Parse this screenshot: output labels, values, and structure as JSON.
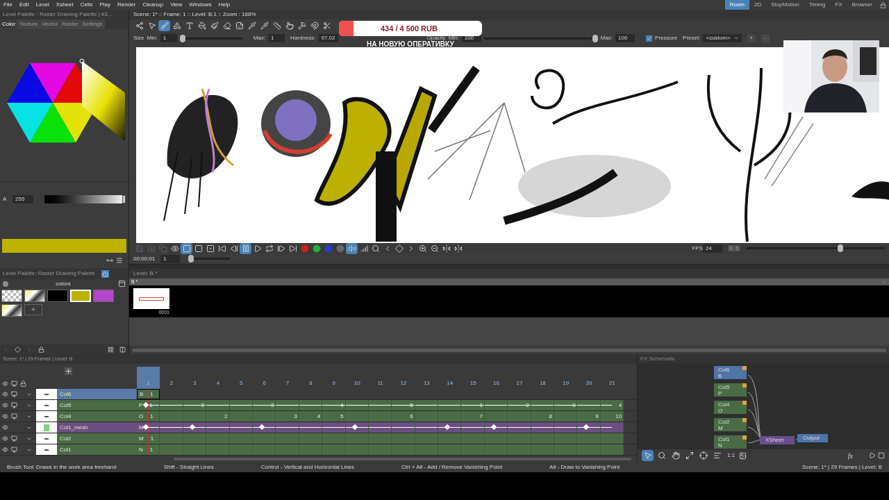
{
  "menu": [
    "File",
    "Edit",
    "Level",
    "Xsheet",
    "Cells",
    "Play",
    "Render",
    "Cleanup",
    "View",
    "Windows",
    "Help"
  ],
  "rooms": [
    {
      "label": "Room",
      "selected": true
    },
    {
      "label": "2D",
      "selected": false
    },
    {
      "label": "StopMotion",
      "selected": false
    },
    {
      "label": "Timing",
      "selected": false
    },
    {
      "label": "FX",
      "selected": false
    },
    {
      "label": "Browser",
      "selected": false
    }
  ],
  "style_editor": {
    "title": "Level Palette : Raster Drawing Palette | #3...",
    "tabs": [
      {
        "label": "Color",
        "selected": true
      },
      {
        "label": "Texture",
        "selected": false
      },
      {
        "label": "Vector",
        "selected": false
      },
      {
        "label": "Raster",
        "selected": false
      },
      {
        "label": "Settings",
        "selected": false
      }
    ],
    "alpha": {
      "label": "A",
      "value": "255",
      "level": 1
    }
  },
  "level_palette": {
    "title": "Level Palette: Raster Drawing Palette",
    "page": "colors",
    "styles": [
      {
        "kind": "checker",
        "selected": false
      },
      {
        "kind": "texture",
        "selected": false
      },
      {
        "kind": "solid",
        "color": "#000000",
        "selected": false
      },
      {
        "kind": "solid",
        "color": "#bcb300",
        "selected": true
      },
      {
        "kind": "solid",
        "color": "#b445c8",
        "selected": false
      },
      {
        "kind": "texture",
        "selected": false
      }
    ],
    "add_label": "+"
  },
  "viewer": {
    "title": "Scene: 1*  ::  Frame: 1  ::  Level: B.1  ::  Zoom : 168%",
    "tools": [
      {
        "selected": false
      },
      {
        "selected": false
      },
      {
        "selected": true
      },
      {
        "selected": false
      },
      {
        "selected": false
      },
      {
        "selected": false
      },
      {
        "selected": false
      },
      {
        "selected": false
      },
      {
        "selected": false
      },
      {
        "selected": false
      },
      {
        "selected": false
      },
      {
        "selected": false
      },
      {
        "selected": false
      },
      {
        "selected": false
      },
      {
        "selected": false
      },
      {
        "selected": false
      }
    ],
    "options": {
      "size": {
        "label": "Size",
        "min_label": "Min:",
        "min": "1",
        "level": 0,
        "max_label": "Max:",
        "max": "1"
      },
      "hardness": {
        "label": "Hardness:",
        "value": "97.02"
      },
      "opacity": {
        "label": "Opacity",
        "min_label": "Min:",
        "min": "100",
        "level": 1,
        "max_label": "Max:",
        "max": "100"
      },
      "pressure": {
        "label": "Pressure",
        "checked": true
      },
      "preset": {
        "label": "Preset:",
        "value": "<custom>"
      },
      "preset_buttons": [
        "+",
        "-"
      ]
    }
  },
  "playback": {
    "buttons": [
      {
        "selected": false
      },
      {
        "selected": false
      },
      {
        "selected": false
      },
      {
        "selected": false
      },
      {
        "selected": true
      },
      {
        "selected": false
      },
      {
        "selected": false
      },
      {
        "selected": false
      },
      {
        "selected": false
      },
      {
        "selected": true
      },
      {
        "selected": false
      },
      {
        "selected": false
      },
      {
        "selected": false
      },
      {
        "selected": false
      },
      {
        "selected": false
      },
      {
        "selected": false
      },
      {
        "selected": false
      },
      {
        "selected": false
      },
      {
        "selected": true
      },
      {
        "selected": false
      },
      {
        "selected": false
      },
      {
        "selected": false
      },
      {
        "selected": false
      },
      {
        "selected": false
      },
      {
        "selected": false
      },
      {
        "selected": false
      },
      {
        "selected": false
      },
      {
        "selected": false
      }
    ],
    "time": "00:00:01",
    "frame": "1",
    "fps_label": "FPS",
    "fps": "24",
    "speed": {
      "level": 0.69
    },
    "frame_slider": {
      "level": 0
    }
  },
  "level_strip": {
    "title": "Level:  B *",
    "header": "B *",
    "frames": [
      {
        "label": "0001"
      }
    ]
  },
  "xsheet": {
    "header": "Scene: 1*  |  29 Frames  |  Level: B",
    "frames": [
      {
        "label": "1",
        "selected": true
      },
      {
        "label": "2",
        "selected": false
      },
      {
        "label": "3",
        "selected": false
      },
      {
        "label": "4",
        "selected": false
      },
      {
        "label": "5",
        "selected": false
      },
      {
        "label": "6",
        "selected": false
      },
      {
        "label": "7",
        "selected": false
      },
      {
        "label": "8",
        "selected": false
      },
      {
        "label": "9",
        "selected": false
      },
      {
        "label": "10",
        "selected": false
      },
      {
        "label": "11",
        "selected": false
      },
      {
        "label": "12",
        "selected": false
      },
      {
        "label": "13",
        "selected": false
      },
      {
        "label": "14",
        "selected": false
      },
      {
        "label": "15",
        "selected": false
      },
      {
        "label": "16",
        "selected": false
      },
      {
        "label": "17",
        "selected": false
      },
      {
        "label": "18",
        "selected": false
      },
      {
        "label": "19",
        "selected": false
      },
      {
        "label": "20",
        "selected": false
      },
      {
        "label": "21",
        "selected": false
      }
    ],
    "columns": [
      {
        "name": "Col6",
        "kind": "level",
        "selected": true,
        "camstand": true,
        "letter": "B",
        "cells": [
          {
            "key": false,
            "label": "1"
          }
        ]
      },
      {
        "name": "Col5",
        "kind": "level",
        "selected": false,
        "camstand": true,
        "letter": "P",
        "cells": [
          {
            "key": true,
            "label": "1"
          },
          {
            "key": false
          },
          {
            "key": false,
            "label": "2"
          },
          {
            "key": false
          },
          {
            "key": false
          },
          {
            "key": false,
            "label": "3"
          },
          {
            "key": false
          },
          {
            "key": false
          },
          {
            "key": false,
            "label": "4"
          },
          {
            "key": false
          },
          {
            "key": false
          },
          {
            "key": false,
            "label": "5"
          },
          {
            "key": false
          },
          {
            "key": false
          },
          {
            "key": false,
            "label": "1"
          },
          {
            "key": false
          },
          {
            "key": false,
            "label": "2"
          },
          {
            "key": false
          },
          {
            "key": false,
            "label": "3"
          },
          {
            "key": false
          },
          {
            "key": false,
            "label": "4"
          }
        ]
      },
      {
        "name": "Col4",
        "kind": "level",
        "selected": false,
        "camstand": true,
        "letter": "O",
        "cells": [
          {
            "key": false,
            "label": "1"
          },
          {
            "key": false
          },
          {
            "key": false
          },
          {
            "key": false,
            "label": "2"
          },
          {
            "key": false
          },
          {
            "key": false
          },
          {
            "key": false,
            "label": "3"
          },
          {
            "key": false,
            "label": "4"
          },
          {
            "key": false,
            "label": "5"
          },
          {
            "key": false
          },
          {
            "key": false
          },
          {
            "key": false,
            "label": "6"
          },
          {
            "key": false
          },
          {
            "key": false
          },
          {
            "key": false,
            "label": "7"
          },
          {
            "key": false
          },
          {
            "key": false
          },
          {
            "key": false,
            "label": "8"
          },
          {
            "key": false
          },
          {
            "key": false,
            "label": "9"
          },
          {
            "key": false,
            "label": "10"
          }
        ]
      },
      {
        "name": "Col1_mesh",
        "kind": "mesh",
        "selected": false,
        "camstand": false,
        "letter": "M",
        "cells": [
          {
            "key": true
          },
          {
            "key": false
          },
          {
            "key": true
          },
          {
            "key": false
          },
          {
            "key": false
          },
          {
            "key": true
          },
          {
            "key": false
          },
          {
            "key": false
          },
          {
            "key": false
          },
          {
            "key": true
          },
          {
            "key": false
          },
          {
            "key": false
          },
          {
            "key": false
          },
          {
            "key": true
          },
          {
            "key": false
          },
          {
            "key": true
          },
          {
            "key": false
          },
          {
            "key": false
          },
          {
            "key": false
          },
          {
            "key": true
          },
          {
            "key": false
          }
        ]
      },
      {
        "name": "Col2",
        "kind": "level",
        "selected": false,
        "camstand": true,
        "letter": "M",
        "cells": [
          {
            "key": false,
            "label": "1"
          },
          {
            "key": false
          },
          {
            "key": false
          },
          {
            "key": false
          },
          {
            "key": false
          },
          {
            "key": false
          },
          {
            "key": false
          },
          {
            "key": false
          },
          {
            "key": false
          },
          {
            "key": false
          },
          {
            "key": false
          },
          {
            "key": false
          },
          {
            "key": false
          },
          {
            "key": false
          },
          {
            "key": false
          },
          {
            "key": false
          },
          {
            "key": false
          },
          {
            "key": false
          },
          {
            "key": false
          },
          {
            "key": false
          },
          {
            "key": false
          }
        ]
      },
      {
        "name": "Col1",
        "kind": "level",
        "selected": false,
        "camstand": true,
        "letter": "N",
        "cells": [
          {
            "key": false,
            "label": "1"
          },
          {
            "key": false
          },
          {
            "key": false
          },
          {
            "key": false
          },
          {
            "key": false
          },
          {
            "key": false
          },
          {
            "key": false
          },
          {
            "key": false
          },
          {
            "key": false
          },
          {
            "key": false
          },
          {
            "key": false
          },
          {
            "key": false
          },
          {
            "key": false
          },
          {
            "key": false
          },
          {
            "key": false
          },
          {
            "key": false
          },
          {
            "key": false
          },
          {
            "key": false
          },
          {
            "key": false
          },
          {
            "key": false
          },
          {
            "key": false
          }
        ]
      }
    ]
  },
  "fx_schematic": {
    "title": "FX Schematic",
    "nodes": [
      {
        "name": "Col6",
        "level": "B",
        "selected": true
      },
      {
        "name": "Col5",
        "level": "P",
        "selected": false
      },
      {
        "name": "Col4",
        "level": "O",
        "selected": false
      },
      {
        "name": "Col2",
        "level": "M",
        "selected": false
      },
      {
        "name": "Col1",
        "level": "N",
        "selected": false
      }
    ],
    "xsheet_node": "XSheet",
    "output_node": "Output",
    "tools": [
      {
        "selected": true
      },
      {
        "selected": false
      },
      {
        "selected": false
      },
      {
        "selected": false
      },
      {
        "selected": false
      },
      {
        "selected": false
      }
    ],
    "zoom_label": "1:1",
    "fx_label": "fx"
  },
  "status_bar": {
    "hints": [
      "Brush Tool: Draws in the work area freehand",
      "Shift - Straight Lines",
      "Control - Vertical and Horizontal Lines",
      "Ctrl + Alt - Add / Remove Vanishing Point",
      "Alt - Draw to Vanishing Point"
    ],
    "summary": "Scene: 1*  |  29 Frames  |  Level: B"
  },
  "donation": {
    "amount": "434 / 4 500 RUB",
    "level": 0.1,
    "caption": "НА НОВУЮ ОПЕРАТИВКУ"
  }
}
